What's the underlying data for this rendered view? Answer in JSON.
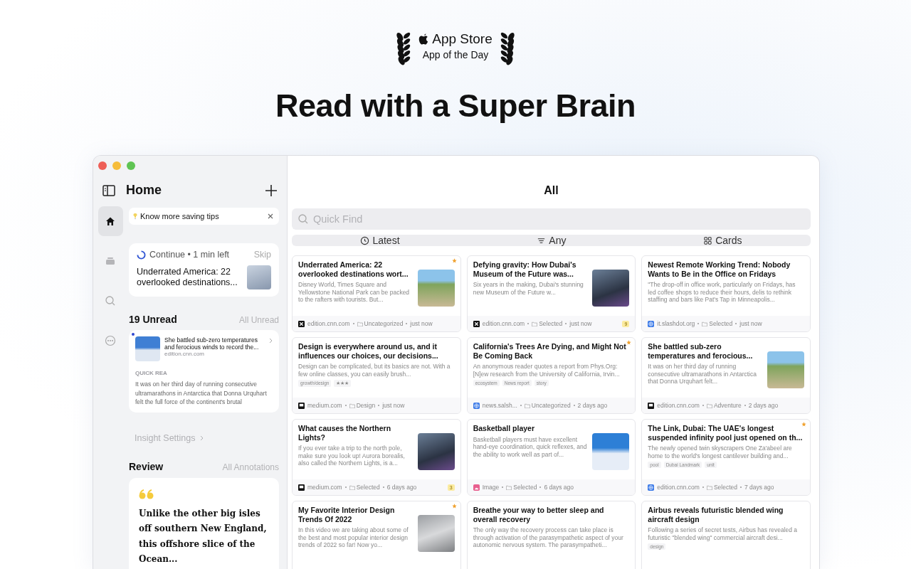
{
  "award": {
    "store": "App Store",
    "title": "App of the Day"
  },
  "headline": "Read with a Super Brain",
  "sidebar": {
    "title": "Home",
    "rail": [
      {
        "kind": "home",
        "selected": true
      },
      {
        "kind": "stack",
        "selected": false
      },
      {
        "kind": "search",
        "selected": false
      },
      {
        "kind": "more",
        "selected": false
      }
    ],
    "tip": {
      "text": "Know more saving tips"
    },
    "continue": {
      "label": "Continue • 1 min left",
      "skip": "Skip",
      "title": "Underrated America: 22 overlooked destinations..."
    },
    "unread": {
      "heading": "19 Unread",
      "link": "All Unread",
      "item": {
        "unread": true,
        "title": "She battled sub-zero temperatures and ferocious winds to record the...",
        "source": "edition.cnn.com",
        "section": "QUICK REA",
        "excerpt": "It was on her third day of running consecutive ultramarathons in Antarctica that Donna Urquhart felt the full force of the continent's brutal"
      }
    },
    "insight": "Insight Settings",
    "review": {
      "heading": "Review",
      "link": "All Annotations",
      "quote": "Unlike the other big isles off southern New England, this offshore slice of the Ocean..."
    }
  },
  "main": {
    "title": "All",
    "search": {
      "placeholder": "Quick Find"
    },
    "filters": [
      {
        "kind": "latest",
        "label": "Latest"
      },
      {
        "kind": "any",
        "label": "Any"
      },
      {
        "kind": "cards",
        "label": "Cards"
      }
    ],
    "cards": [
      {
        "kind": "cross",
        "title": "Underrated America: 22 overlooked destinations wort...",
        "excerpt": "Disney World, Times Square and Yellowstone National Park can be packed to the rafters with tourists. But...",
        "thumbnail": true,
        "starred": true,
        "source": "edition.cnn.com",
        "folder": "Uncategorized",
        "time": "just now"
      },
      {
        "kind": "cross",
        "title": "Defying gravity: How Dubai's Museum of the Future was...",
        "excerpt": "Six years in the making, Dubai's stunning new Museum of the Future w...",
        "thumbnail": true,
        "starred": false,
        "source": "edition.cnn.com",
        "folder": "Selected",
        "time": "just now",
        "badge": "9"
      },
      {
        "kind": "globe",
        "title": "Newest Remote Working Trend: Nobody Wants to Be in the Office on Fridays",
        "excerpt": "\"The drop-off in office work, particularly on Fridays, has led coffee shops to reduce their hours, delis to rethink staffing and bars like Pat's Tap in Minneapolis...",
        "thumbnail": false,
        "starred": false,
        "source": "it.slashdot.org",
        "folder": "Selected",
        "time": "just now"
      },
      {
        "kind": "block",
        "title": "Design is everywhere around us, and it influences our choices, our decisions...",
        "excerpt": "Design can be complicated, but its basics are not. With a few online classes, you can easily brush...",
        "thumbnail": false,
        "starred": false,
        "tags": [
          "growth/design",
          "★★★"
        ],
        "source": "medium.com",
        "folder": "Design",
        "time": "just now"
      },
      {
        "kind": "globe",
        "title": "California's Trees Are Dying, and Might Not Be Coming Back",
        "excerpt": "An anonymous reader quotes a report from Phys.Org: [N]ew research from the University of California, Irvin...",
        "thumbnail": false,
        "starred": true,
        "tags": [
          "ecosystem",
          "News report",
          "story"
        ],
        "source": "news.salsh...",
        "folder": "Uncategorized",
        "time": "2 days ago"
      },
      {
        "kind": "block",
        "title": "She battled sub-zero temperatures and ferocious...",
        "excerpt": "It was on her third day of running consecutive ultramarathons in Antarctica that Donna Urquhart felt...",
        "thumbnail": true,
        "starred": false,
        "source": "edition.cnn.com",
        "folder": "Adventure",
        "time": "2 days ago"
      },
      {
        "kind": "block",
        "title": "What causes the Northern Lights?",
        "excerpt": "If you ever take a trip to the north pole, make sure you look up! Aurora borealis, also called the Northern Lights, is a...",
        "thumbnail": true,
        "starred": false,
        "source": "medium.com",
        "folder": "Selected",
        "time": "6 days ago",
        "badge": "3"
      },
      {
        "kind": "image",
        "title": "Basketball player",
        "excerpt": "Basketball players must have excellent hand-eye coordination, quick reflexes, and the ability to work well as part of...",
        "thumbnail": true,
        "starred": false,
        "source": "Image",
        "folder": "Selected",
        "time": "6 days ago"
      },
      {
        "kind": "globe",
        "title": "The Link, Dubai: The UAE's longest suspended infinity pool just opened on th...",
        "excerpt": "The newly opened twin skyscrapers One Za'abeel are home to the world's longest cantilever building and...",
        "thumbnail": false,
        "starred": true,
        "tags": [
          "pool",
          "Dubai Landmark",
          "unit"
        ],
        "source": "edition.cnn.com",
        "folder": "Selected",
        "time": "7 days ago"
      },
      {
        "title": "My Favorite Interior Design Trends Of 2022",
        "excerpt": "In this video we are taking about some of the best and most popular interior design trends of 2022 so far!  Now yo...",
        "thumbnail": true,
        "starred": true
      },
      {
        "title": "Breathe your way to better sleep and overall recovery",
        "excerpt": "The only way the recovery process can take place is through activation of the parasympathetic aspect of your autonomic nervous system. The parasympatheti...",
        "thumbnail": false,
        "starred": false
      },
      {
        "title": "Airbus reveals futuristic blended wing aircraft design",
        "excerpt": "Following a series of secret tests, Airbus has revealed a futuristic \"blended wing\" commercial aircraft desi...",
        "thumbnail": false,
        "starred": false,
        "tags": [
          "design"
        ]
      }
    ]
  }
}
